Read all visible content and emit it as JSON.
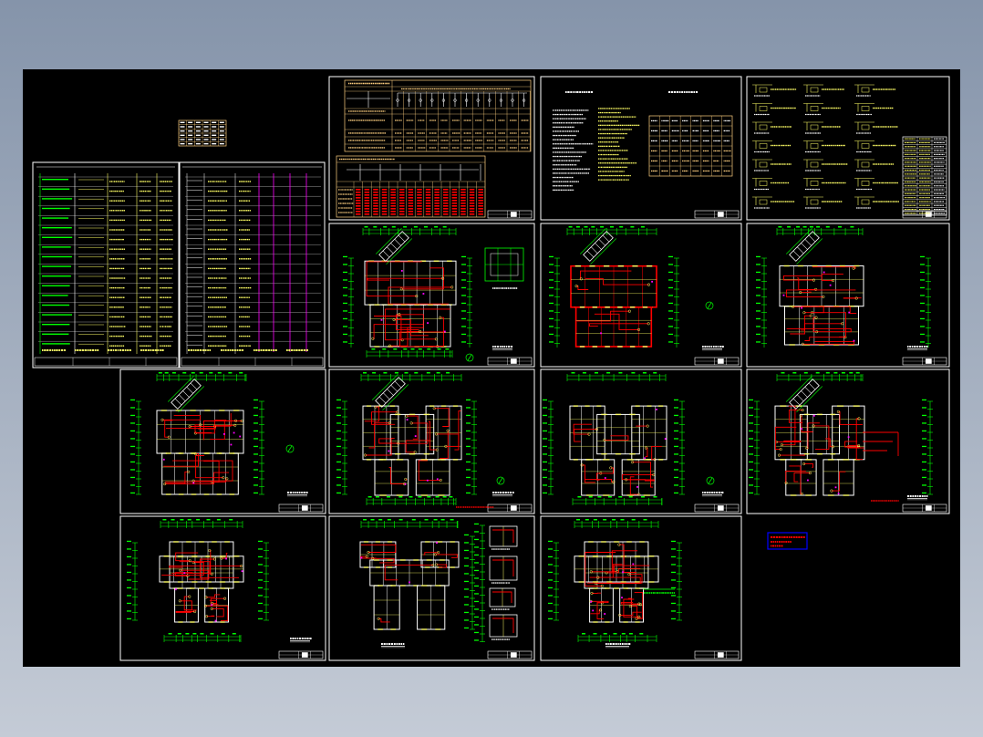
{
  "colors": {
    "backdrop_top": "#8594aa",
    "backdrop_bottom": "#c4cbd6",
    "canvas": "#000000",
    "sheet_border": "#ffffff",
    "dimension_line": "#00ff00",
    "wall_line": "#ffffff",
    "fixture_line": "#ffff66",
    "wiring_line": "#ff0000",
    "accent_line": "#ff00ff",
    "table_line": "#ffd080",
    "legend_box_border": "#0000ff",
    "legend_box_text": "#ff0000"
  }
}
